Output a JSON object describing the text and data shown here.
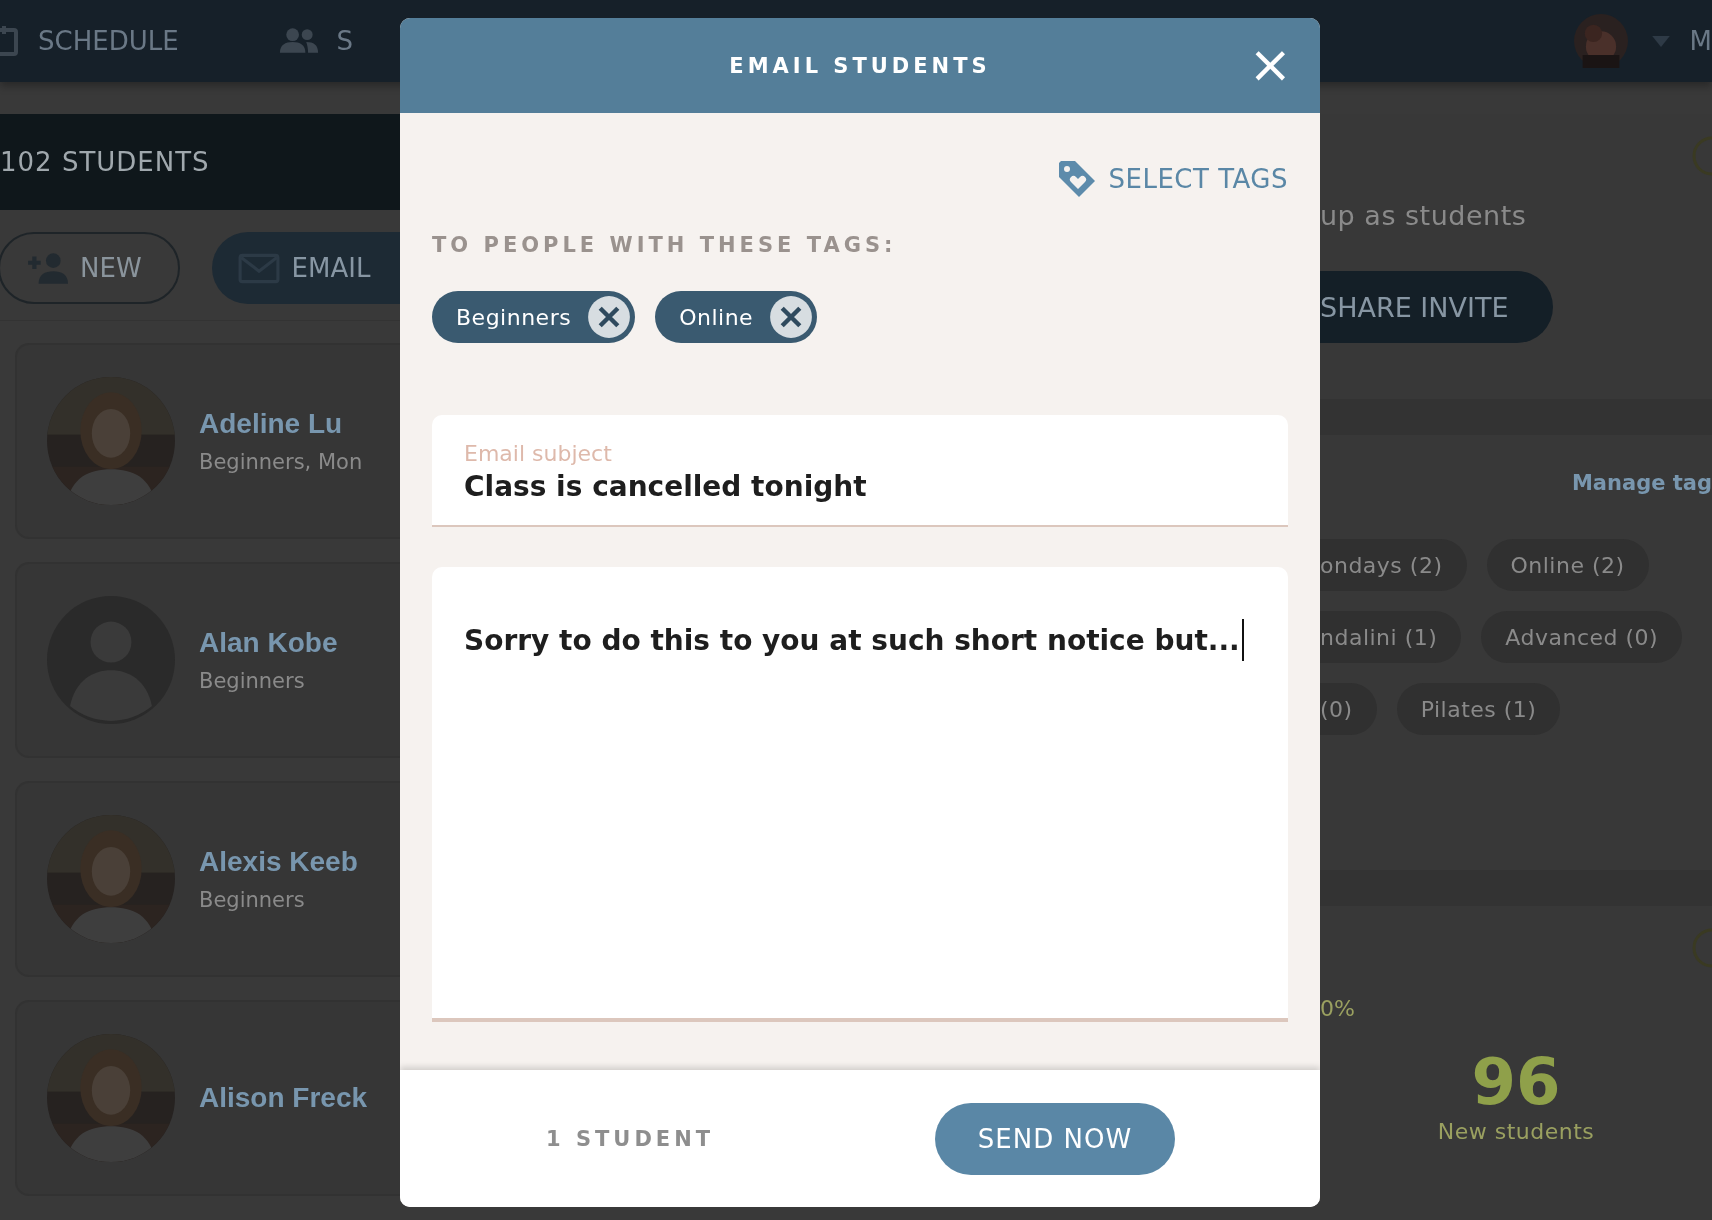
{
  "top_nav": {
    "items": [
      {
        "label": "SCHEDULE"
      },
      {
        "label": "S"
      }
    ],
    "account_label": "M"
  },
  "students_panel": {
    "title": "102 STUDENTS",
    "buttons": [
      {
        "label": "NEW"
      },
      {
        "label": "EMAIL"
      }
    ],
    "students": [
      {
        "name": "Adeline Lu",
        "tags": "Beginners, Mon",
        "kind": "picture"
      },
      {
        "name": "Alan Kobe",
        "tags": "Beginners",
        "kind": "placeholder"
      },
      {
        "name": "Alexis Keeb",
        "tags": "Beginners",
        "kind": "picture"
      },
      {
        "name": "Alison Freck",
        "kind": "picture"
      }
    ]
  },
  "side_panel": {
    "invite_text": "up as students",
    "invite_button": "SHARE INVITE",
    "manage_tags_link": "Manage tag",
    "tag_rows": [
      [
        "ondays (2)",
        "Online (2)"
      ],
      [
        "ndalini (1)",
        "Advanced (0)"
      ],
      [
        "(0)",
        "Pilates (1)"
      ]
    ],
    "stat_percent": "0%",
    "stat_value": "96",
    "stat_label": "New students"
  },
  "dialog": {
    "title": "EMAIL STUDENTS",
    "close": "×",
    "select_tags_button": "SELECT TAGS",
    "recipients_label": "TO PEOPLE WITH THESE TAGS:",
    "selected_tags": [
      {
        "label": "Beginners"
      },
      {
        "label": "Online"
      }
    ],
    "subject": {
      "label": "Email subject",
      "value": "Class is cancelled tonight"
    },
    "message": {
      "value": "Sorry to do this to you at such short notice but..."
    },
    "recipient_count": "1 STUDENT",
    "send_button": "SEND NOW"
  }
}
